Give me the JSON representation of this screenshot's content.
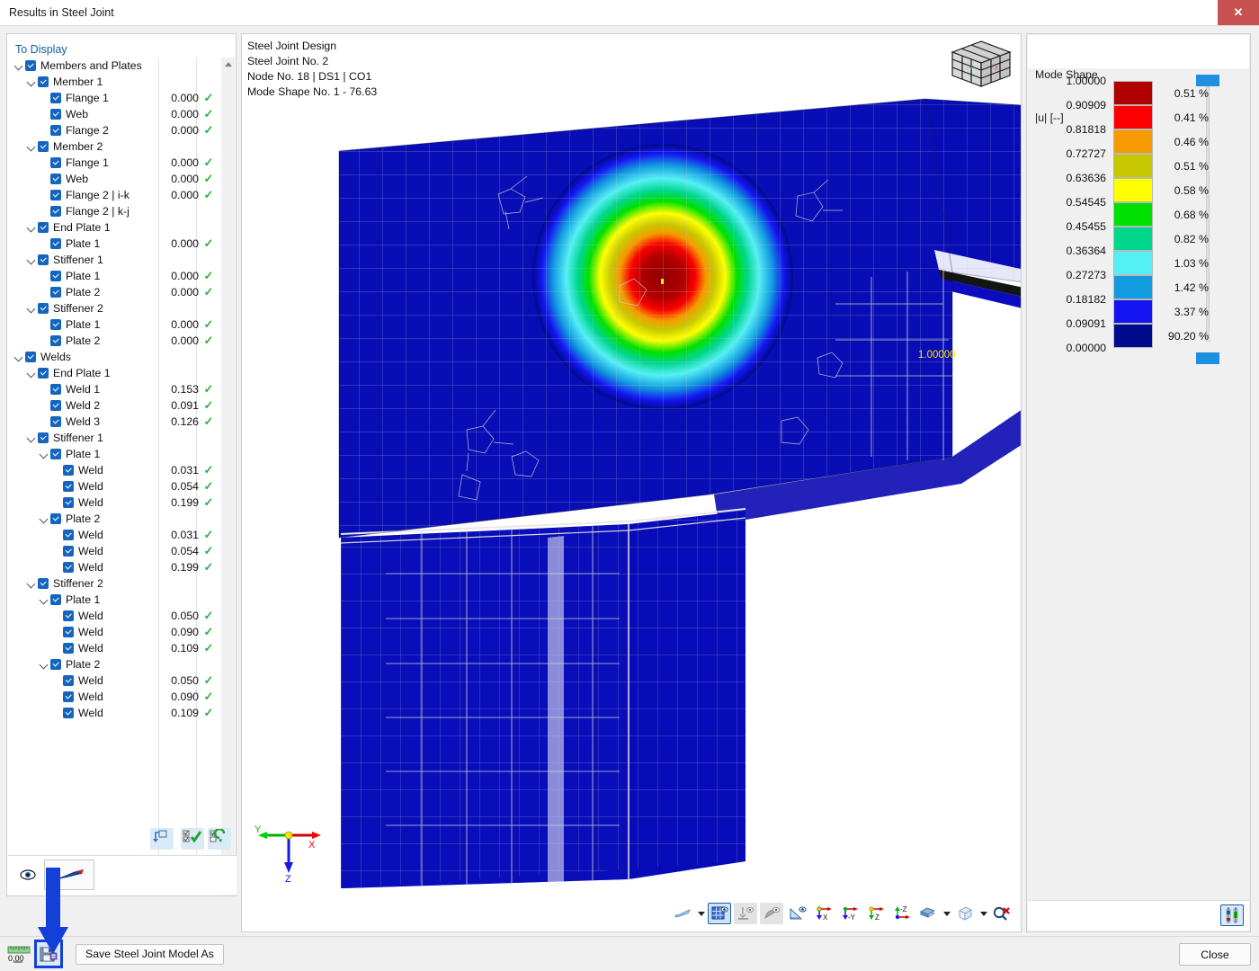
{
  "window": {
    "title": "Results in Steel Joint",
    "close_icon": "close-x-icon",
    "close_label": "✕"
  },
  "tree_panel": {
    "header": "To Display",
    "check_mark": "✓",
    "rows": [
      {
        "depth": 0,
        "chevron": true,
        "label": "Members and Plates",
        "value": "",
        "ok": false
      },
      {
        "depth": 1,
        "chevron": true,
        "label": "Member 1",
        "value": "",
        "ok": false
      },
      {
        "depth": 2,
        "chevron": false,
        "label": "Flange 1",
        "value": "0.000",
        "ok": true
      },
      {
        "depth": 2,
        "chevron": false,
        "label": "Web",
        "value": "0.000",
        "ok": true
      },
      {
        "depth": 2,
        "chevron": false,
        "label": "Flange 2",
        "value": "0.000",
        "ok": true
      },
      {
        "depth": 1,
        "chevron": true,
        "label": "Member 2",
        "value": "",
        "ok": false
      },
      {
        "depth": 2,
        "chevron": false,
        "label": "Flange 1",
        "value": "0.000",
        "ok": true
      },
      {
        "depth": 2,
        "chevron": false,
        "label": "Web",
        "value": "0.000",
        "ok": true
      },
      {
        "depth": 2,
        "chevron": false,
        "label": "Flange 2 | i-k",
        "value": "0.000",
        "ok": true
      },
      {
        "depth": 2,
        "chevron": false,
        "label": "Flange 2 | k-j",
        "value": "",
        "ok": false
      },
      {
        "depth": 1,
        "chevron": true,
        "label": "End Plate 1",
        "value": "",
        "ok": false
      },
      {
        "depth": 2,
        "chevron": false,
        "label": "Plate 1",
        "value": "0.000",
        "ok": true
      },
      {
        "depth": 1,
        "chevron": true,
        "label": "Stiffener 1",
        "value": "",
        "ok": false
      },
      {
        "depth": 2,
        "chevron": false,
        "label": "Plate 1",
        "value": "0.000",
        "ok": true
      },
      {
        "depth": 2,
        "chevron": false,
        "label": "Plate 2",
        "value": "0.000",
        "ok": true
      },
      {
        "depth": 1,
        "chevron": true,
        "label": "Stiffener 2",
        "value": "",
        "ok": false
      },
      {
        "depth": 2,
        "chevron": false,
        "label": "Plate 1",
        "value": "0.000",
        "ok": true
      },
      {
        "depth": 2,
        "chevron": false,
        "label": "Plate 2",
        "value": "0.000",
        "ok": true
      },
      {
        "depth": 0,
        "chevron": true,
        "label": "Welds",
        "value": "",
        "ok": false
      },
      {
        "depth": 1,
        "chevron": true,
        "label": "End Plate 1",
        "value": "",
        "ok": false
      },
      {
        "depth": 2,
        "chevron": false,
        "label": "Weld 1",
        "value": "0.153",
        "ok": true
      },
      {
        "depth": 2,
        "chevron": false,
        "label": "Weld 2",
        "value": "0.091",
        "ok": true
      },
      {
        "depth": 2,
        "chevron": false,
        "label": "Weld 3",
        "value": "0.126",
        "ok": true
      },
      {
        "depth": 1,
        "chevron": true,
        "label": "Stiffener 1",
        "value": "",
        "ok": false
      },
      {
        "depth": 2,
        "chevron": true,
        "label": "Plate 1",
        "value": "",
        "ok": false
      },
      {
        "depth": 3,
        "chevron": false,
        "label": "Weld",
        "value": "0.031",
        "ok": true
      },
      {
        "depth": 3,
        "chevron": false,
        "label": "Weld",
        "value": "0.054",
        "ok": true
      },
      {
        "depth": 3,
        "chevron": false,
        "label": "Weld",
        "value": "0.199",
        "ok": true
      },
      {
        "depth": 2,
        "chevron": true,
        "label": "Plate 2",
        "value": "",
        "ok": false
      },
      {
        "depth": 3,
        "chevron": false,
        "label": "Weld",
        "value": "0.031",
        "ok": true
      },
      {
        "depth": 3,
        "chevron": false,
        "label": "Weld",
        "value": "0.054",
        "ok": true
      },
      {
        "depth": 3,
        "chevron": false,
        "label": "Weld",
        "value": "0.199",
        "ok": true
      },
      {
        "depth": 1,
        "chevron": true,
        "label": "Stiffener 2",
        "value": "",
        "ok": false
      },
      {
        "depth": 2,
        "chevron": true,
        "label": "Plate 1",
        "value": "",
        "ok": false
      },
      {
        "depth": 3,
        "chevron": false,
        "label": "Weld",
        "value": "0.050",
        "ok": true
      },
      {
        "depth": 3,
        "chevron": false,
        "label": "Weld",
        "value": "0.090",
        "ok": true
      },
      {
        "depth": 3,
        "chevron": false,
        "label": "Weld",
        "value": "0.109",
        "ok": true
      },
      {
        "depth": 2,
        "chevron": true,
        "label": "Plate 2",
        "value": "",
        "ok": false
      },
      {
        "depth": 3,
        "chevron": false,
        "label": "Weld",
        "value": "0.050",
        "ok": true
      },
      {
        "depth": 3,
        "chevron": false,
        "label": "Weld",
        "value": "0.090",
        "ok": true
      },
      {
        "depth": 3,
        "chevron": false,
        "label": "Weld",
        "value": "0.109",
        "ok": true
      }
    ],
    "footer_buttons": [
      {
        "name": "reset-selection-button"
      },
      {
        "name": "check-all-button"
      },
      {
        "name": "invert-selection-button"
      }
    ],
    "bottom_bar": {
      "eye_icon": "eye-icon",
      "style_preview": "render-style-preview"
    },
    "scrollbar": {
      "up": "▲",
      "down": "▼"
    }
  },
  "viewport": {
    "caption": "Steel Joint Design\nSteel Joint No. 2\nNode No. 18 | DS1 | CO1\nMode Shape No. 1 - 76.63",
    "caption_lines": [
      "Steel Joint Design",
      "Steel Joint No. 2",
      "Node No. 18 | DS1 | CO1",
      "Mode Shape No. 1 - 76.63"
    ],
    "peak_label": "1.00000",
    "axes": {
      "x": "X",
      "y": "Y",
      "z": "Z"
    },
    "navcube": {
      "x_face": "-X",
      "y_face": "-Y"
    },
    "toolbar": [
      {
        "name": "render-mode-button",
        "icon": "surface-icon"
      },
      {
        "name": "render-mode-dropdown",
        "icon": "chevron-down-icon"
      },
      {
        "name": "show-mesh-button",
        "icon": "mesh-grid-icon",
        "selected": true
      },
      {
        "name": "show-supports-button",
        "icon": "support-icon",
        "disabled": true
      },
      {
        "name": "show-loads-button",
        "icon": "load-icon",
        "disabled": true
      },
      {
        "name": "show-dimensions-button",
        "icon": "dimension-icon"
      },
      {
        "name": "view-x-button",
        "icon": "axis-x-icon"
      },
      {
        "name": "view-negy-button",
        "icon": "axis-negy-icon"
      },
      {
        "name": "view-z-button",
        "icon": "axis-z-icon"
      },
      {
        "name": "view-negz-button",
        "icon": "axis-negz-icon"
      },
      {
        "name": "view-iso-button",
        "icon": "solid-stack-icon"
      },
      {
        "name": "view-iso-dropdown",
        "icon": "chevron-down-icon"
      },
      {
        "name": "projection-button",
        "icon": "wire-cube-icon"
      },
      {
        "name": "projection-dropdown",
        "icon": "chevron-down-icon"
      },
      {
        "name": "zoom-reset-button",
        "icon": "magnifier-clear-icon"
      }
    ]
  },
  "legend": {
    "title_line1": "Mode Shape",
    "title_line2": "|u| [--]",
    "settings_icon": "legend-settings-icon",
    "values": [
      "1.00000",
      "0.90909",
      "0.81818",
      "0.72727",
      "0.63636",
      "0.54545",
      "0.45455",
      "0.36364",
      "0.27273",
      "0.18182",
      "0.09091",
      "0.00000"
    ],
    "bands": [
      {
        "color": "#b00000",
        "percent": "0.51 %"
      },
      {
        "color": "#fa0000",
        "percent": "0.41 %"
      },
      {
        "color": "#f59a00",
        "percent": "0.46 %"
      },
      {
        "color": "#c8c800",
        "percent": "0.51 %"
      },
      {
        "color": "#ffff00",
        "percent": "0.58 %"
      },
      {
        "color": "#00e000",
        "percent": "0.68 %"
      },
      {
        "color": "#00d68c",
        "percent": "0.82 %"
      },
      {
        "color": "#55f0f5",
        "percent": "1.03 %"
      },
      {
        "color": "#139be0",
        "percent": "1.42 %"
      },
      {
        "color": "#1414f0",
        "percent": "3.37 %"
      },
      {
        "color": "#000a8c",
        "percent": "90.20 %"
      }
    ],
    "slider_color": "#1e90e0"
  },
  "chart_data": {
    "type": "heatmap",
    "title": "Mode Shape |u| [--]",
    "colorbar_ticks": [
      1.0,
      0.90909,
      0.81818,
      0.72727,
      0.63636,
      0.54545,
      0.45455,
      0.36364,
      0.27273,
      0.18182,
      0.09091,
      0.0
    ],
    "band_percentages": [
      0.51,
      0.41,
      0.46,
      0.51,
      0.58,
      0.68,
      0.82,
      1.03,
      1.42,
      3.37,
      90.2
    ],
    "band_colors": [
      "#b00000",
      "#fa0000",
      "#f59a00",
      "#c8c800",
      "#ffff00",
      "#00e000",
      "#00d68c",
      "#55f0f5",
      "#139be0",
      "#1414f0",
      "#000a8c"
    ],
    "peak_value": 1.0,
    "peak_label": "1.00000",
    "mode_number": 1,
    "mode_frequency": 76.63,
    "legend_position": "right",
    "ylabel": "|u| [--]",
    "xlabel": ""
  },
  "statusbar": {
    "measure_icon": "ruler-icon",
    "measure_value": "0.00",
    "save_model_icon": "save-model-icon",
    "save_as_label": "Save Steel Joint Model As",
    "close_label": "Close"
  },
  "annotation": {
    "arrow_color": "#1340d8",
    "points_to": "save-model-icon"
  }
}
